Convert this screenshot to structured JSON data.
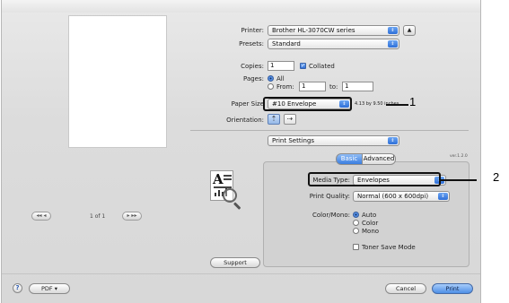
{
  "printer": {
    "label": "Printer:",
    "value": "Brother HL-3070CW series"
  },
  "presets": {
    "label": "Presets:",
    "value": "Standard"
  },
  "copies": {
    "label": "Copies:",
    "value": "1",
    "collated_label": "Collated"
  },
  "pages": {
    "label": "Pages:",
    "all_label": "All",
    "from_label": "From:",
    "from_value": "1",
    "to_label": "to:",
    "to_value": "1"
  },
  "paper_size": {
    "label": "Paper Size",
    "value": "#10 Envelope",
    "dimensions": "4.13 by 9.50 inches"
  },
  "orientation": {
    "label": "Orientation:",
    "portrait_glyph": "⇡",
    "landscape_glyph": "⇢"
  },
  "section_popup": {
    "value": "Print Settings"
  },
  "tabs": {
    "basic": "Basic",
    "advanced": "Advanced",
    "version": "ver.1.2.0"
  },
  "media_type": {
    "label": "Media Type:",
    "value": "Envelopes"
  },
  "print_quality": {
    "label": "Print Quality:",
    "value": "Normal (600 x 600dpi)"
  },
  "color_mono": {
    "label": "Color/Mono:",
    "options": [
      "Auto",
      "Color",
      "Mono"
    ],
    "selected": "Auto"
  },
  "toner_save": {
    "label": "Toner Save Mode"
  },
  "preview": {
    "prev_label": "◂◂ ◂",
    "next_label": "▸ ▸▸",
    "page_counter": "1 of 1"
  },
  "buttons": {
    "support": "Support",
    "pdf": "PDF ▾",
    "cancel": "Cancel",
    "print": "Print",
    "help": "?"
  },
  "callouts": {
    "one": "1",
    "two": "2"
  },
  "colors": {
    "accent": "#3a7ee0",
    "callout": "#111111"
  },
  "icons": [
    "help-icon",
    "disclosure-icon",
    "popup-arrows-icon",
    "portrait-icon",
    "landscape-icon",
    "document-magnifier-icon"
  ]
}
